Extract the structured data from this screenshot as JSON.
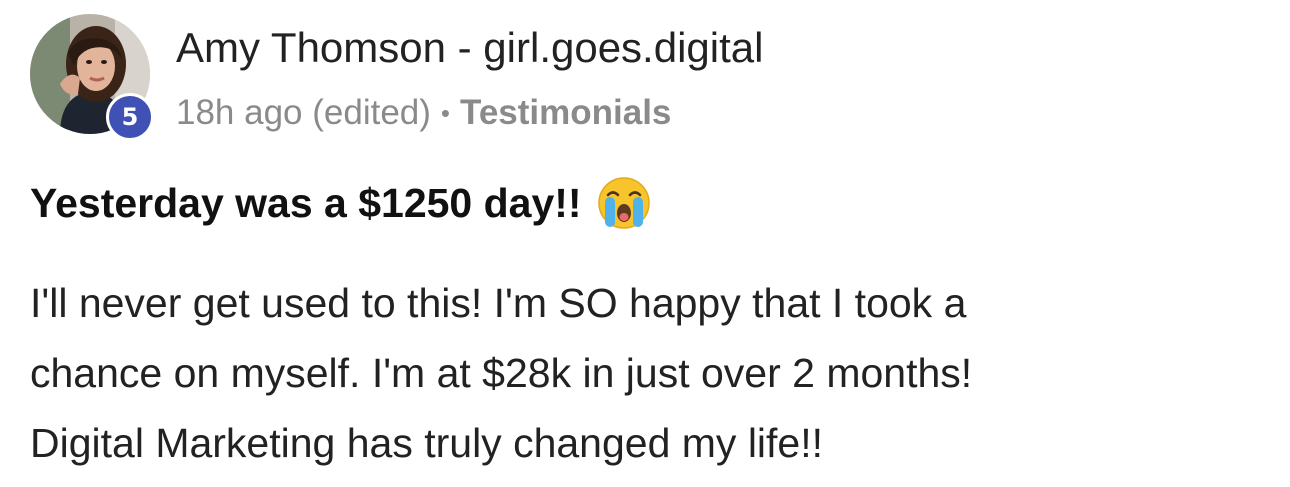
{
  "post": {
    "author_name": "Amy Thomson - girl.goes.digital",
    "level": "5",
    "time_ago": "18h ago (edited)",
    "separator": "•",
    "category": "Testimonials",
    "title": "Yesterday was a $1250 day!!",
    "title_emoji": "loudly-crying-face-icon",
    "body_lines": [
      "I'll never get used to this! I'm SO happy that I took a",
      "chance on myself. I'm at $28k in just over 2 months!",
      "Digital Marketing has truly changed my life!!"
    ]
  },
  "colors": {
    "level_badge": "#3f51b5",
    "meta_text": "#8a8a8a",
    "text": "#222222"
  }
}
